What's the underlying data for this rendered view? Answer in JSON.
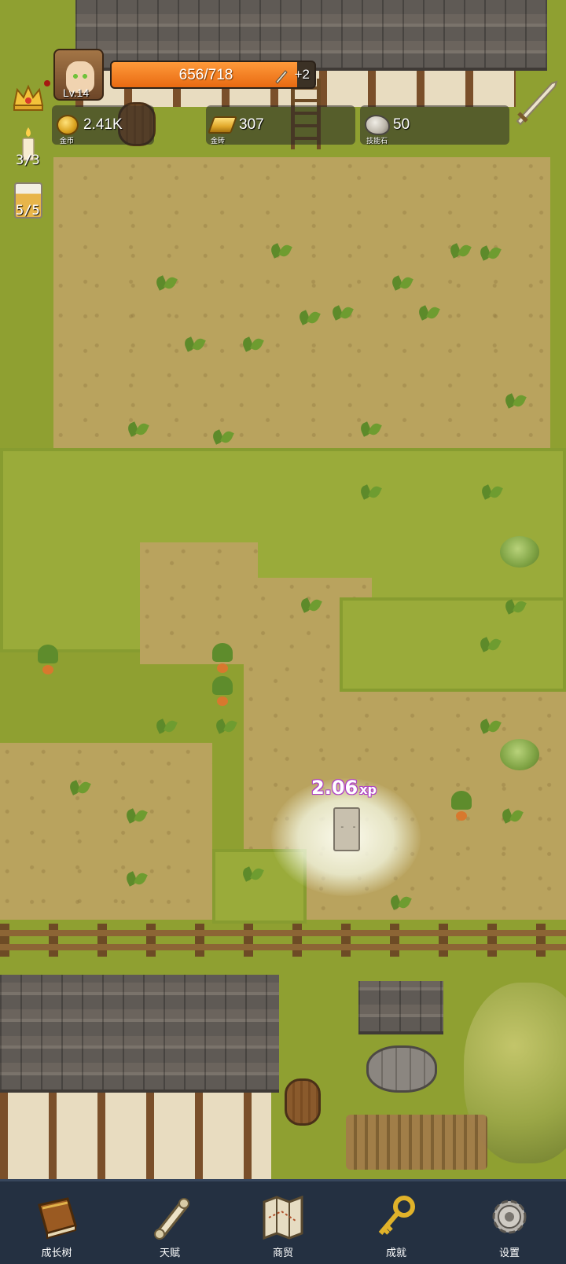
{
  "hud": {
    "level": "Lv.14",
    "hp_text": "656/718",
    "hp_fraction": 0.914,
    "hp_bonus": "+2",
    "resources": [
      {
        "value": "2.41K",
        "caption": "金币",
        "icon": "coin-icon"
      },
      {
        "value": "307",
        "caption": "金砖",
        "icon": "gold-bar-icon"
      },
      {
        "value": "50",
        "caption": "技能石",
        "icon": "skill-stone-icon"
      }
    ],
    "side_items": [
      {
        "icon": "crown-icon"
      },
      {
        "icon": "candle-icon",
        "count": "3/3"
      },
      {
        "icon": "beer-mug-icon",
        "count": "5/5"
      }
    ]
  },
  "field": {
    "xp_popup_value": "2.06",
    "xp_popup_unit": "xp"
  },
  "nav": {
    "items": [
      {
        "label": "成长树",
        "icon": "book-icon"
      },
      {
        "label": "天赋",
        "icon": "scroll-icon"
      },
      {
        "label": "商贸",
        "icon": "map-icon"
      },
      {
        "label": "成就",
        "icon": "key-icon"
      },
      {
        "label": "设置",
        "icon": "gear-icon"
      }
    ]
  },
  "colors": {
    "hp_fill": "#e86a12",
    "nav_background": "#243041",
    "xp_outline": "#b040c8"
  }
}
